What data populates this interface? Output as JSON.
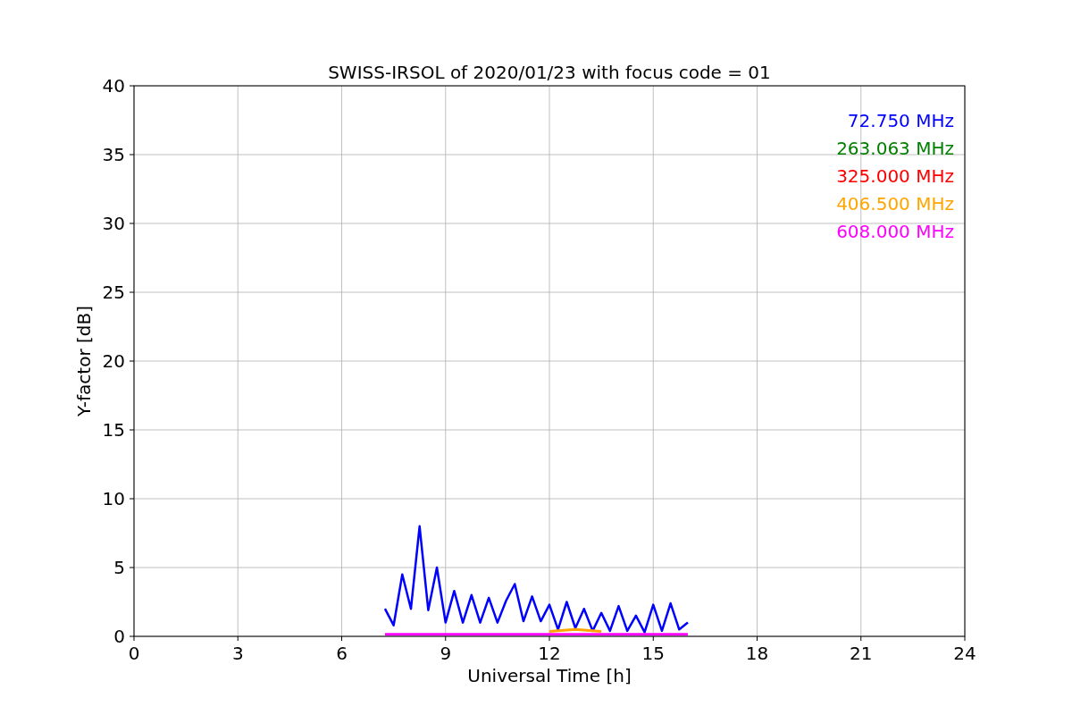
{
  "chart_data": {
    "type": "line",
    "grid": true,
    "title": "SWISS-IRSOL of 2020/01/23 with focus code = 01",
    "xlabel": "Universal Time [h]",
    "ylabel": "Y-factor [dB]",
    "xlim": [
      0,
      24
    ],
    "ylim": [
      0,
      40
    ],
    "xticks": [
      0,
      3,
      6,
      9,
      12,
      15,
      18,
      21,
      24
    ],
    "yticks": [
      0,
      5,
      10,
      15,
      20,
      25,
      30,
      35,
      40
    ],
    "x": [
      7.25,
      7.5,
      7.75,
      8.0,
      8.25,
      8.5,
      8.75,
      9.0,
      9.25,
      9.5,
      9.75,
      10.0,
      10.25,
      10.5,
      10.75,
      11.0,
      11.25,
      11.5,
      11.75,
      12.0,
      12.25,
      12.5,
      12.75,
      13.0,
      13.25,
      13.5,
      13.75,
      14.0,
      14.25,
      14.5,
      14.75,
      15.0,
      15.25,
      15.5,
      15.75,
      16.0
    ],
    "series": [
      {
        "name": "72.750 MHz",
        "color": "#0000ff",
        "values": [
          2.0,
          0.8,
          4.5,
          2.0,
          8.0,
          1.9,
          5.0,
          1.0,
          3.3,
          1.0,
          3.0,
          1.0,
          2.8,
          1.0,
          2.6,
          3.8,
          1.1,
          2.9,
          1.1,
          2.3,
          0.5,
          2.5,
          0.6,
          2.0,
          0.4,
          1.7,
          0.4,
          2.2,
          0.4,
          1.5,
          0.3,
          2.3,
          0.4,
          2.4,
          0.5,
          1.0
        ]
      },
      {
        "name": "263.063 MHz",
        "color": "#008000",
        "values": [
          null,
          null,
          null,
          null,
          null,
          null,
          null,
          null,
          null,
          null,
          null,
          null,
          null,
          null,
          null,
          null,
          null,
          null,
          null,
          null,
          null,
          null,
          null,
          null,
          null,
          null,
          null,
          null,
          null,
          null,
          null,
          null,
          null,
          null,
          null,
          null
        ]
      },
      {
        "name": "325.000 MHz",
        "color": "#ff0000",
        "values": [
          null,
          null,
          null,
          null,
          null,
          null,
          null,
          null,
          null,
          null,
          null,
          null,
          null,
          null,
          null,
          null,
          null,
          null,
          null,
          null,
          null,
          null,
          null,
          null,
          null,
          null,
          null,
          null,
          null,
          null,
          null,
          null,
          null,
          null,
          null,
          null
        ]
      },
      {
        "name": "406.500 MHz",
        "color": "#ffa500",
        "values": [
          null,
          null,
          null,
          null,
          null,
          null,
          null,
          null,
          null,
          null,
          null,
          null,
          null,
          null,
          null,
          null,
          null,
          null,
          null,
          0.35,
          0.4,
          0.45,
          0.5,
          0.45,
          0.4,
          0.35,
          null,
          null,
          null,
          null,
          null,
          null,
          null,
          null,
          null,
          null
        ]
      },
      {
        "name": "608.000 MHz",
        "color": "#ff00ff",
        "values": [
          0.15,
          0.15,
          0.15,
          0.15,
          0.15,
          0.15,
          0.15,
          0.15,
          0.15,
          0.15,
          0.15,
          0.15,
          0.15,
          0.15,
          0.15,
          0.15,
          0.15,
          0.15,
          0.15,
          0.15,
          0.15,
          0.15,
          0.15,
          0.15,
          0.15,
          0.15,
          0.15,
          0.15,
          0.15,
          0.15,
          0.15,
          0.15,
          0.15,
          0.15,
          0.15,
          0.15
        ]
      }
    ]
  }
}
